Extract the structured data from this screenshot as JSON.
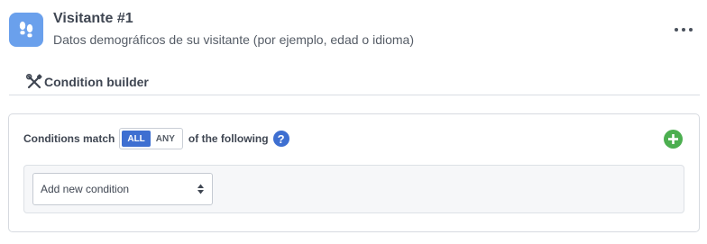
{
  "header": {
    "icon": "footprints-icon",
    "accent_color": "#6aa0ec",
    "title": "Visitante #1",
    "subtitle": "Datos demográficos de su visitante (por ejemplo, edad o idioma)",
    "menu_icon": "more-horizontal-icon"
  },
  "tabs": [
    {
      "icon": "tools-icon",
      "label": "Condition builder"
    }
  ],
  "conditions": {
    "match_label": "Conditions match",
    "match_options": [
      "ALL",
      "ANY"
    ],
    "match_selected": "ALL",
    "following_label": "of the following",
    "help_icon": "question-icon",
    "help_glyph": "?",
    "add_icon": "plus-circle-icon",
    "add_color": "#4caf50",
    "select": {
      "value": "Add new condition",
      "icon": "sort-arrows-icon"
    }
  }
}
